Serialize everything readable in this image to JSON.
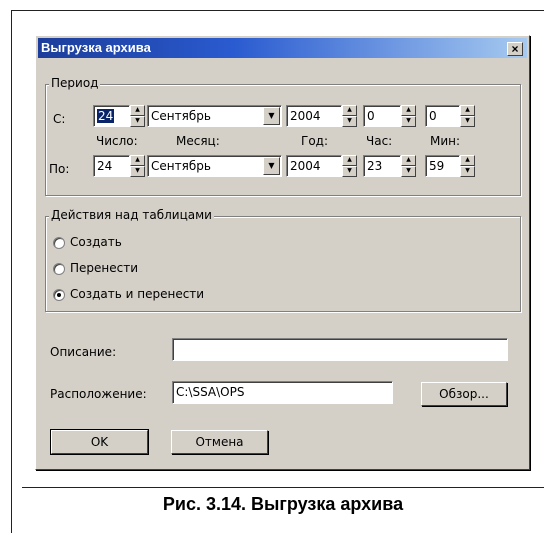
{
  "window": {
    "title": "Выгрузка архива",
    "close_glyph": "×"
  },
  "period": {
    "legend": "Период",
    "from_label": "С:",
    "to_label": "По:",
    "from": {
      "day": "24",
      "month": "Сентябрь",
      "year": "2004",
      "hour": "0",
      "minute": "0"
    },
    "to": {
      "day": "24",
      "month": "Сентябрь",
      "year": "2004",
      "hour": "23",
      "minute": "59"
    },
    "headers": {
      "day": "Число:",
      "month": "Месяц:",
      "year": "Год:",
      "hour": "Час:",
      "minute": "Мин:"
    }
  },
  "actions": {
    "legend": "Действия над таблицами",
    "options": [
      {
        "label": "Создать",
        "checked": false
      },
      {
        "label": "Перенести",
        "checked": false
      },
      {
        "label": "Создать и перенести",
        "checked": true
      }
    ]
  },
  "description": {
    "label": "Описание:",
    "value": ""
  },
  "location": {
    "label": "Расположение:",
    "value": "C:\\SSA\\OPS",
    "browse_label": "Обзор..."
  },
  "buttons": {
    "ok": "OK",
    "cancel": "Отмена"
  },
  "figure_caption": "Рис. 3.14. Выгрузка архива"
}
